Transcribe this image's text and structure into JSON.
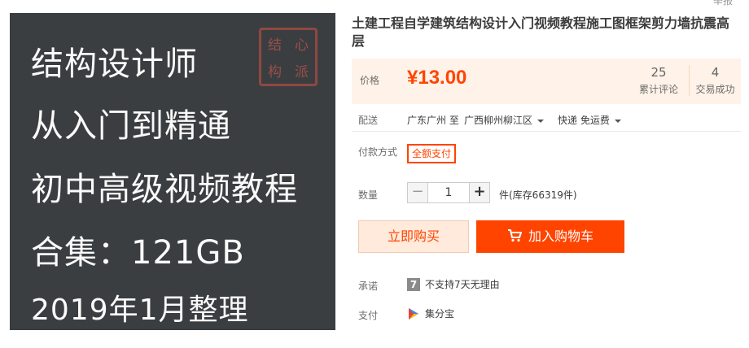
{
  "image": {
    "lines": [
      "结构设计师",
      "从入门到精通",
      "初中高级视频教程",
      "合集：121GB",
      "2019年1月整理"
    ],
    "seal_chars": [
      "结",
      "心",
      "构",
      "派"
    ]
  },
  "top_right": {
    "label": "举报"
  },
  "product": {
    "title": "土建工程自学建筑结构设计入门视频教程施工图框架剪力墙抗震高层"
  },
  "price": {
    "label": "价格",
    "value": "¥13.00",
    "reviews_count": "25",
    "reviews_label": "累计评论",
    "sales_count": "4",
    "sales_label": "交易成功"
  },
  "delivery": {
    "label": "配送",
    "from": "广东广州 至",
    "to": "广西柳州柳江区",
    "shipping": "快递 免运费"
  },
  "payment_method": {
    "label": "付款方式",
    "option": "全额支付"
  },
  "quantity": {
    "label": "数量",
    "minus": "−",
    "value": "1",
    "plus": "+",
    "stock": "件(库存66319件)"
  },
  "actions": {
    "buy_now": "立即购买",
    "add_to_cart": "加入购物车"
  },
  "promise": {
    "label": "承诺",
    "icon_text": "7",
    "text": "不支持7天无理由"
  },
  "payment": {
    "label": "支付",
    "text": "集分宝"
  },
  "colors": {
    "accent": "#ff4400",
    "price_bg": "#fff2e8",
    "board": "#3b3e40"
  },
  "icons": [
    "zoom-icon",
    "cart-icon",
    "seven-day-icon",
    "jifenbao-icon",
    "chevron-down-icon"
  ]
}
